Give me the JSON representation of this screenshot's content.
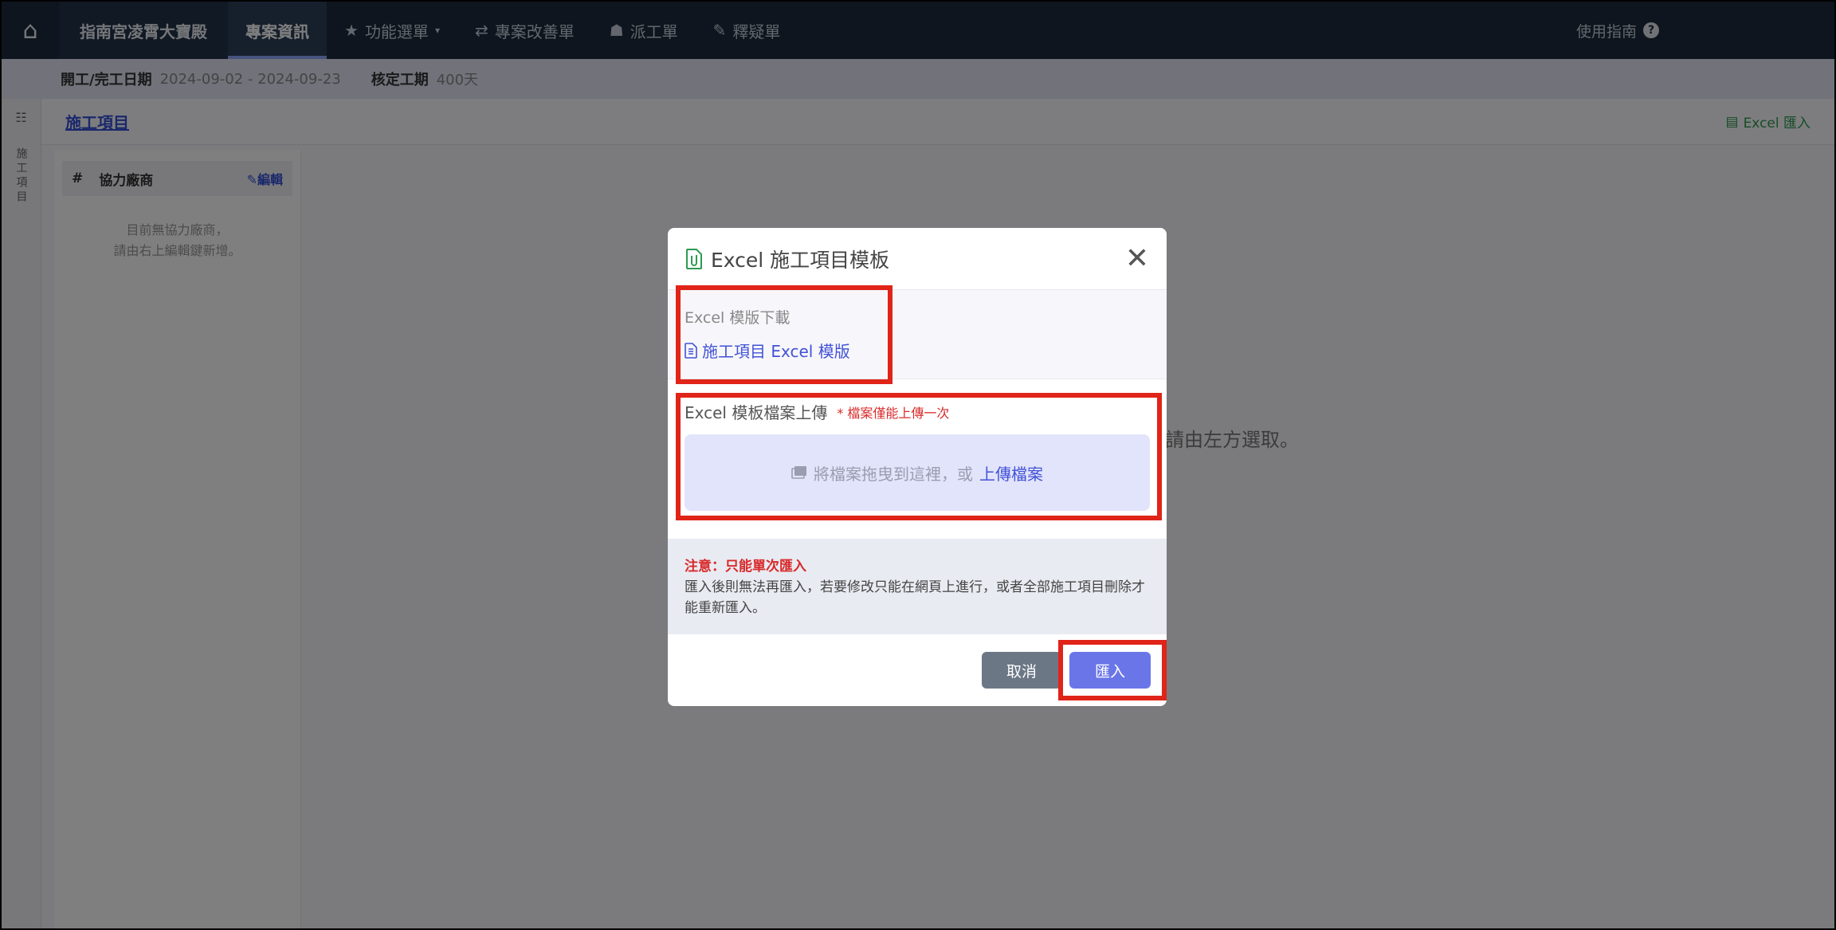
{
  "nav": {
    "brand": "指南宮凌霄大寶殿",
    "items": [
      {
        "label": "專案資訊",
        "icon": "",
        "active": true
      },
      {
        "label": "功能選單",
        "icon": "★",
        "active": false,
        "dropdown": true
      },
      {
        "label": "專案改善單",
        "icon": "⇄",
        "active": false
      },
      {
        "label": "派工單",
        "icon": "☗",
        "active": false
      },
      {
        "label": "釋疑單",
        "icon": "✎",
        "active": false
      }
    ],
    "help_label": "使用指南",
    "help_icon": "?"
  },
  "subbar": {
    "date_label": "開工/完工日期",
    "date_value": "2024-09-02 - 2024-09-23",
    "duration_label": "核定工期",
    "duration_value": "400天"
  },
  "rail": {
    "text": "施工項目"
  },
  "page": {
    "title": "施工項目",
    "excel_import": "Excel 匯入",
    "content_hint": "請由左方選取。"
  },
  "panel": {
    "col_hash": "#",
    "col_vendor": "協力廠商",
    "edit_label": "編輯",
    "empty_line1": "目前無協力廠商，",
    "empty_line2": "請由右上編輯鍵新增。"
  },
  "modal": {
    "title": "Excel 施工項目模板",
    "download_label": "Excel 模版下載",
    "download_link": "施工項目 Excel 模版",
    "upload_label": "Excel 模板檔案上傳",
    "upload_note": "* 檔案僅能上傳一次",
    "dropzone_text": "將檔案拖曳到這裡，或",
    "dropzone_link": "上傳檔案",
    "notice_title": "注意：只能單次匯入",
    "notice_body": "匯入後則無法再匯入，若要修改只能在網頁上進行，或者全部施工項目刪除才能重新匯入。",
    "cancel": "取消",
    "import": "匯入"
  },
  "colors": {
    "nav_bg": "#1c2a3d",
    "accent": "#6a76e8",
    "link": "#4252d6",
    "danger": "#d82a2a",
    "highlight": "#e02418"
  }
}
